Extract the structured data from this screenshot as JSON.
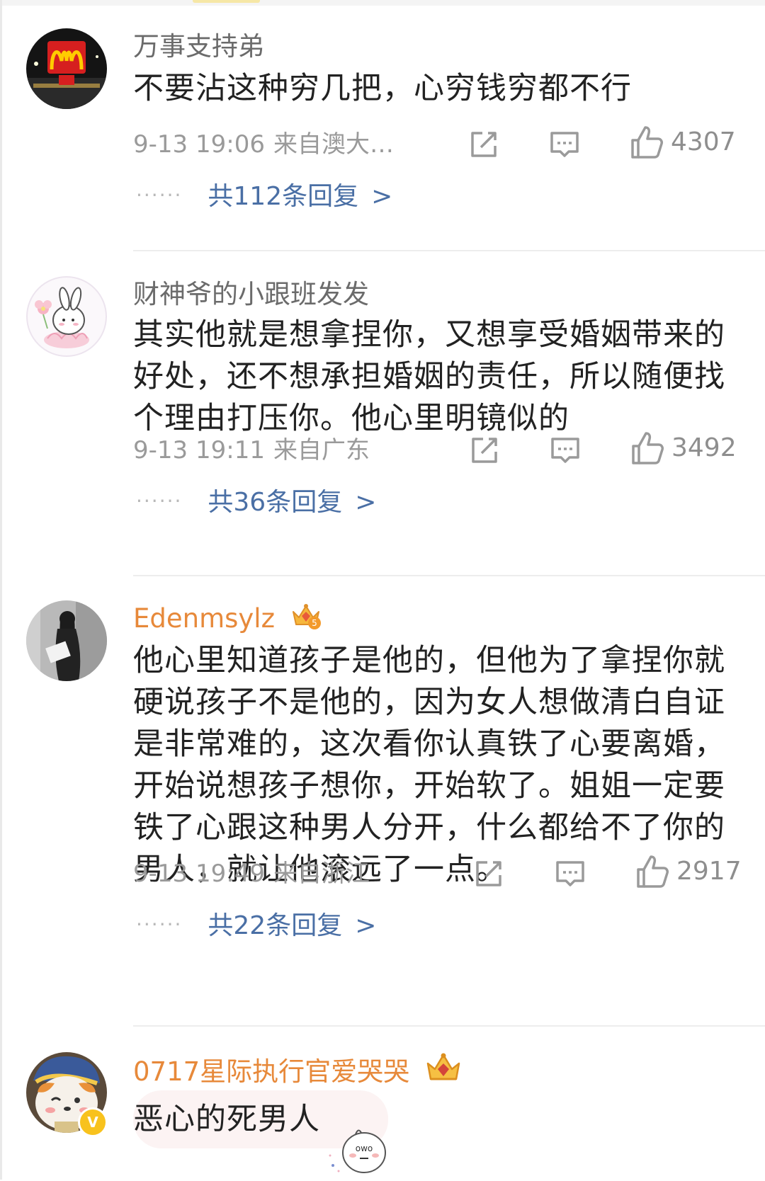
{
  "comments": [
    {
      "username": "万事支持弟",
      "text": "不要沾这种穷几把，心穷钱穷都不行",
      "time": "9-13 19:06",
      "location": "来自澳大…",
      "likes": "4307",
      "replies": "共112条回复",
      "avatar_icon": "mcdonalds-sign-avatar"
    },
    {
      "username": "财神爷的小跟班发发",
      "text": "其实他就是想拿捏你，又想享受婚姻带来的好处，还不想承担婚姻的责任，所以随便找个理由打压你。他心里明镜似的",
      "time": "9-13 19:11",
      "location": "来自广东",
      "likes": "3492",
      "replies": "共36条回复",
      "avatar_icon": "bunny-flower-avatar"
    },
    {
      "username": "Edenmsylz",
      "text": "他心里知道孩子是他的，但他为了拿捏你就硬说孩子不是他的，因为女人想做清白自证是非常难的，这次看你认真铁了心要离婚，开始说想孩子想你，开始软了。姐姐一定要铁了心跟这种男人分开，什么都给不了你的男人，就让他滚远了一点。",
      "time": "9-13 19:49",
      "location": "来自浙江",
      "likes": "2917",
      "replies": "共22条回复",
      "avatar_icon": "girl-silhouette-avatar",
      "badge": "5"
    },
    {
      "username": "0717星际执行官爱哭哭",
      "text": "恶心的死男人",
      "avatar_icon": "shiba-dog-avatar",
      "verified": "V"
    }
  ],
  "colors": {
    "vip_name": "#e7893a",
    "reply_link": "#4a6fa5",
    "meta": "#9a9a9a"
  }
}
